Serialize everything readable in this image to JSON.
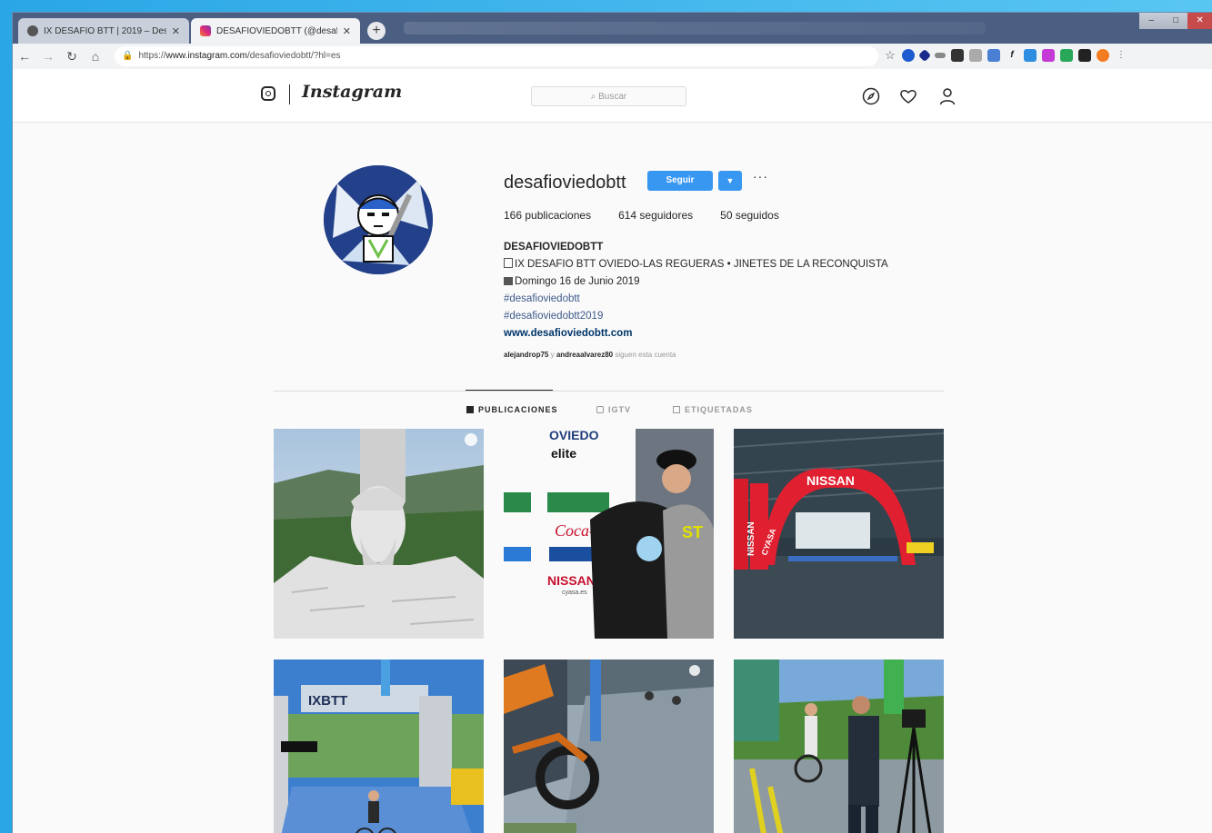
{
  "browser": {
    "tabs": [
      {
        "title": "IX DESAFIO BTT | 2019 – Desafio",
        "active": false
      },
      {
        "title": "DESAFIOVIEDOBTT (@desafiov",
        "active": true
      }
    ],
    "new_tab": "+",
    "url_prefix": "https://",
    "url_host": "www.instagram.com",
    "url_path": "/desafioviedobtt/?hl=es"
  },
  "ig": {
    "wordmark": "Instagram",
    "search_placeholder": "Buscar",
    "profile": {
      "username": "desafioviedobtt",
      "follow": "Seguir",
      "more": "···",
      "stats": {
        "posts": "166 publicaciones",
        "followers": "614 seguidores",
        "following": "50 seguidos"
      },
      "bio": {
        "name": "DESAFIOVIEDOBTT",
        "line1": "IX DESAFIO BTT OVIEDO-LAS REGUERAS • JINETES DE LA RECONQUISTA",
        "line2": "Domingo 16 de Junio 2019",
        "tag1": "#desafioviedobtt",
        "tag2": "#desafioviedobtt2019",
        "website": "www.desafioviedobtt.com"
      },
      "followed_by": {
        "user1": "alejandrop75",
        "joiner": "y",
        "user2": "andreaalvarez80",
        "suffix": "siguen esta cuenta"
      }
    },
    "tabs": {
      "posts": "PUBLICACIONES",
      "igtv": "IGTV",
      "tagged": "ETIQUETADAS"
    },
    "posts": {
      "p2": {
        "top1": "OVIEDO",
        "top2": "elite",
        "sign1": "NISSAN",
        "sign2": "cyasa.es"
      },
      "p3": {
        "arch": "NISSAN",
        "side1": "NISSAN",
        "side2": "CYASA"
      },
      "p4": {
        "banner": "IXBTT"
      }
    }
  }
}
